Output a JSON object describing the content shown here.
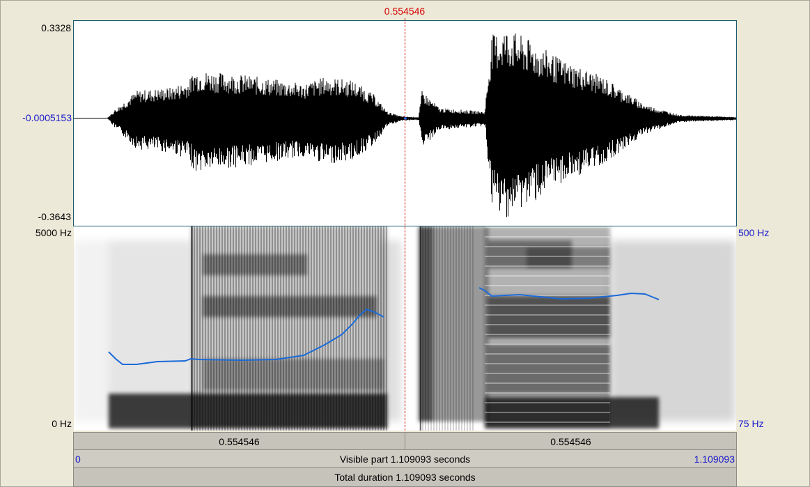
{
  "cursor": {
    "time_label": "0.554546",
    "time_fraction": 0.5
  },
  "waveform": {
    "max_label": "0.3328",
    "center_label": "-0.0005153",
    "min_label": "-0.3643"
  },
  "spectrogram": {
    "freq_max_label": "5000 Hz",
    "freq_min_label": "0 Hz"
  },
  "pitch": {
    "max_label": "500 Hz",
    "min_label": "75 Hz",
    "color": "#1a6ad8"
  },
  "segments": {
    "left_label": "0.554546",
    "right_label": "0.554546"
  },
  "visible": {
    "start_label": "0",
    "text": "Visible part 1.109093 seconds",
    "end_label": "1.109093"
  },
  "total": {
    "text": "Total duration 1.109093 seconds"
  },
  "colors": {
    "cursor": "#d40000",
    "axis_blue": "#1a1acc",
    "background": "#ece9d8"
  }
}
